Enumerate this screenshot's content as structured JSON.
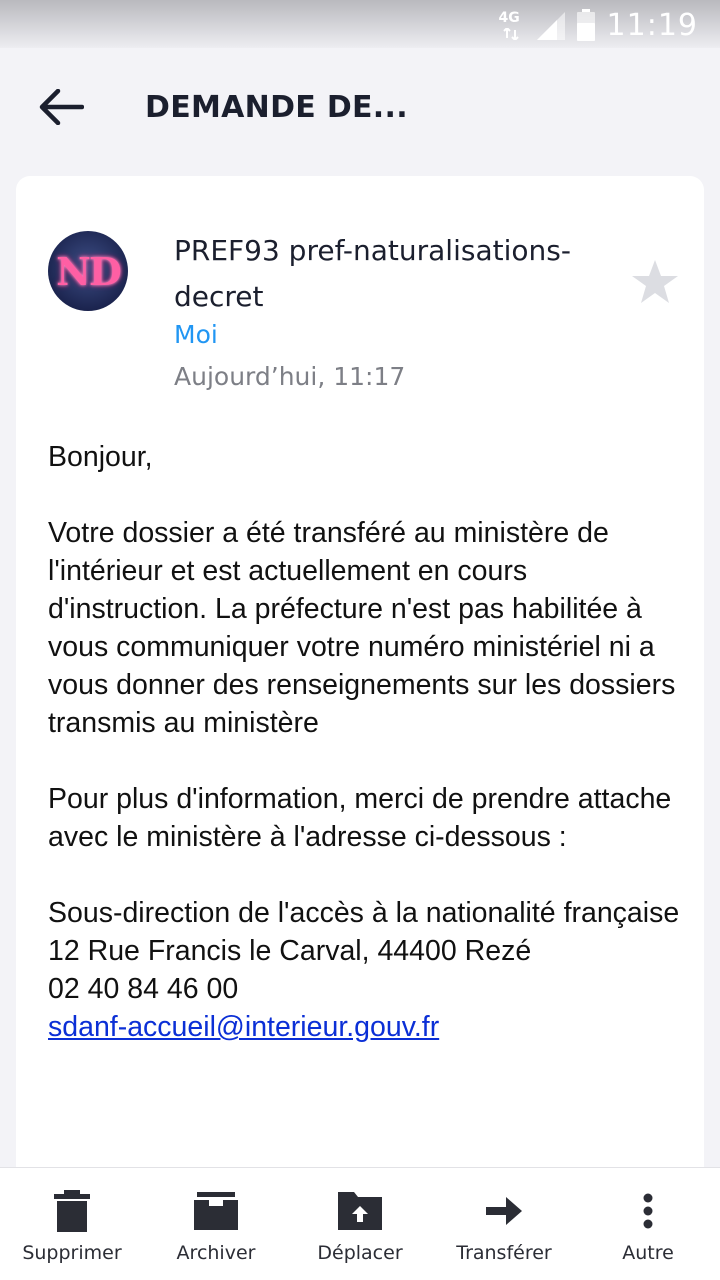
{
  "status_bar": {
    "network": "4G",
    "time": "11:19"
  },
  "header": {
    "title": "DEMANDE DE..."
  },
  "email": {
    "avatar_initials": "ND",
    "sender": "PREF93 pref-naturalisations-decret",
    "recipient": "Moi",
    "date": "Aujourd’hui, 11:17",
    "starred": false,
    "body": {
      "greeting": "Bonjour,",
      "paragraph1": "Votre dossier a été transféré au ministère de l'intérieur et est actuellement en cours d'instruction. La préfecture n'est pas habilitée à vous communiquer votre numéro ministériel ni a vous donner des renseignements sur les dossiers transmis au ministère",
      "paragraph2": "Pour plus d'information, merci de prendre attache avec le ministère à l'adresse ci-dessous :",
      "address_line1": "Sous-direction de l'accès à la nationalité française",
      "address_line2": "12 Rue Francis le Carval, 44400 Rezé",
      "phone": "02 40 84 46 00",
      "email_link": "sdanf-accueil@interieur.gouv.fr"
    }
  },
  "toolbar": {
    "delete_label": "Supprimer",
    "archive_label": "Archiver",
    "move_label": "Déplacer",
    "forward_label": "Transférer",
    "more_label": "Autre"
  },
  "icons": {
    "back": "arrow-left-icon",
    "star": "star-icon",
    "delete": "trash-icon",
    "archive": "archive-box-icon",
    "move": "folder-move-icon",
    "forward": "arrow-right-icon",
    "more": "more-vertical-icon"
  },
  "colors": {
    "accent_blue": "#2196f3",
    "link_blue": "#0b2fd6",
    "background": "#f3f3f7"
  }
}
